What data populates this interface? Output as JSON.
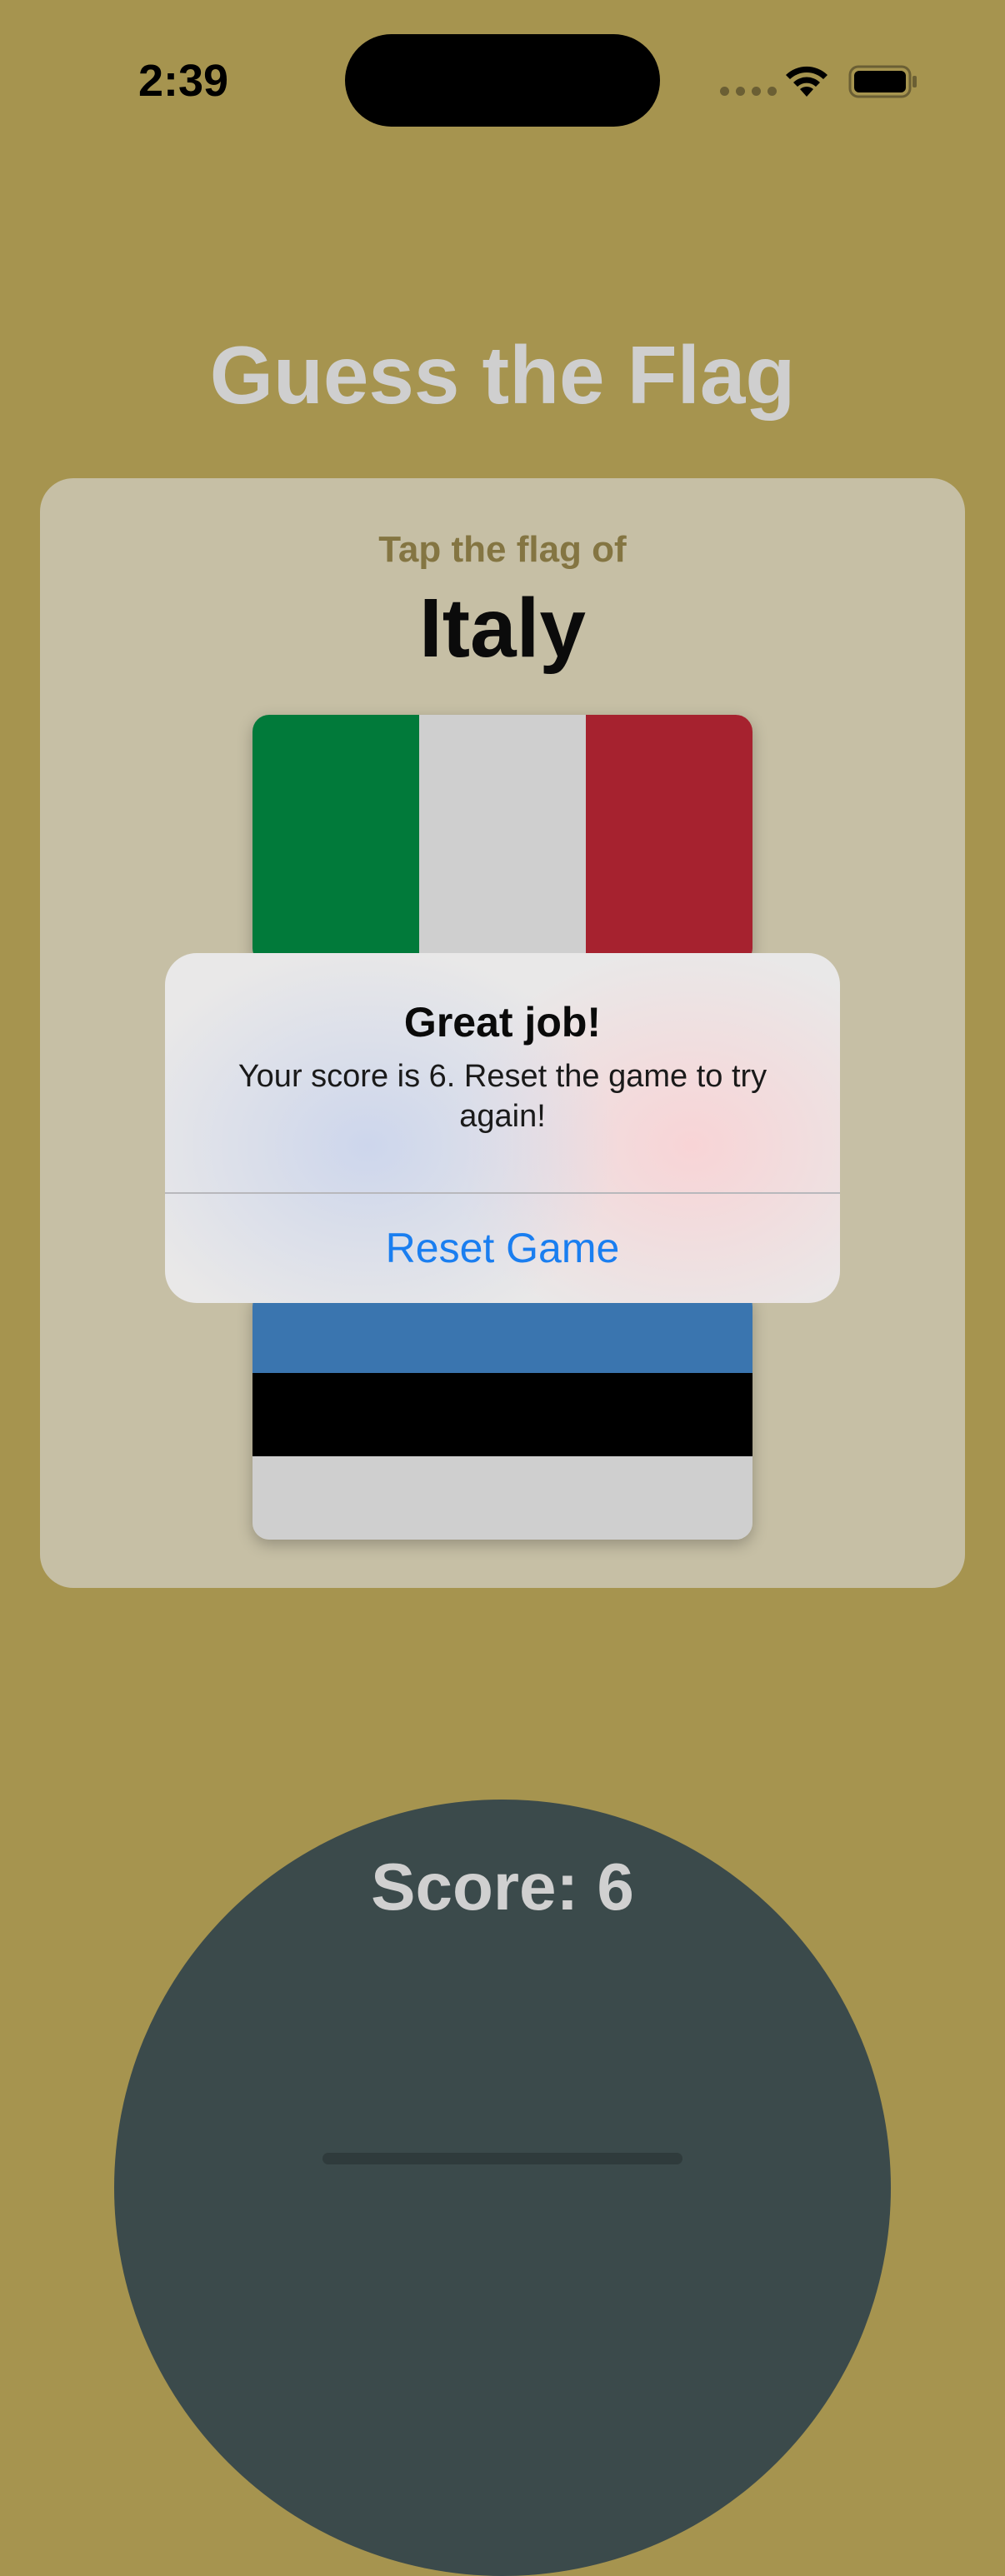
{
  "status_bar": {
    "time": "2:39"
  },
  "app": {
    "title": "Guess the Flag",
    "prompt": "Tap the flag of",
    "country": "Italy",
    "score_text": "Score: 6"
  },
  "flags": {
    "italy": {
      "icon": "flag-of-italy",
      "colors": [
        "#017a3a",
        "#cfcfcf",
        "#a6222f"
      ]
    },
    "estonia": {
      "icon": "flag-of-estonia",
      "colors": [
        "#3a75af",
        "#000000",
        "#cfcfcf"
      ]
    }
  },
  "alert": {
    "title": "Great job!",
    "message": "Your score is 6. Reset the game to try again!",
    "button_label": "Reset Game"
  },
  "colors": {
    "background": "#a6944f",
    "card": "#c6bfa5",
    "score_circle": "#3b4a4b",
    "accent": "#1a7ef0"
  }
}
